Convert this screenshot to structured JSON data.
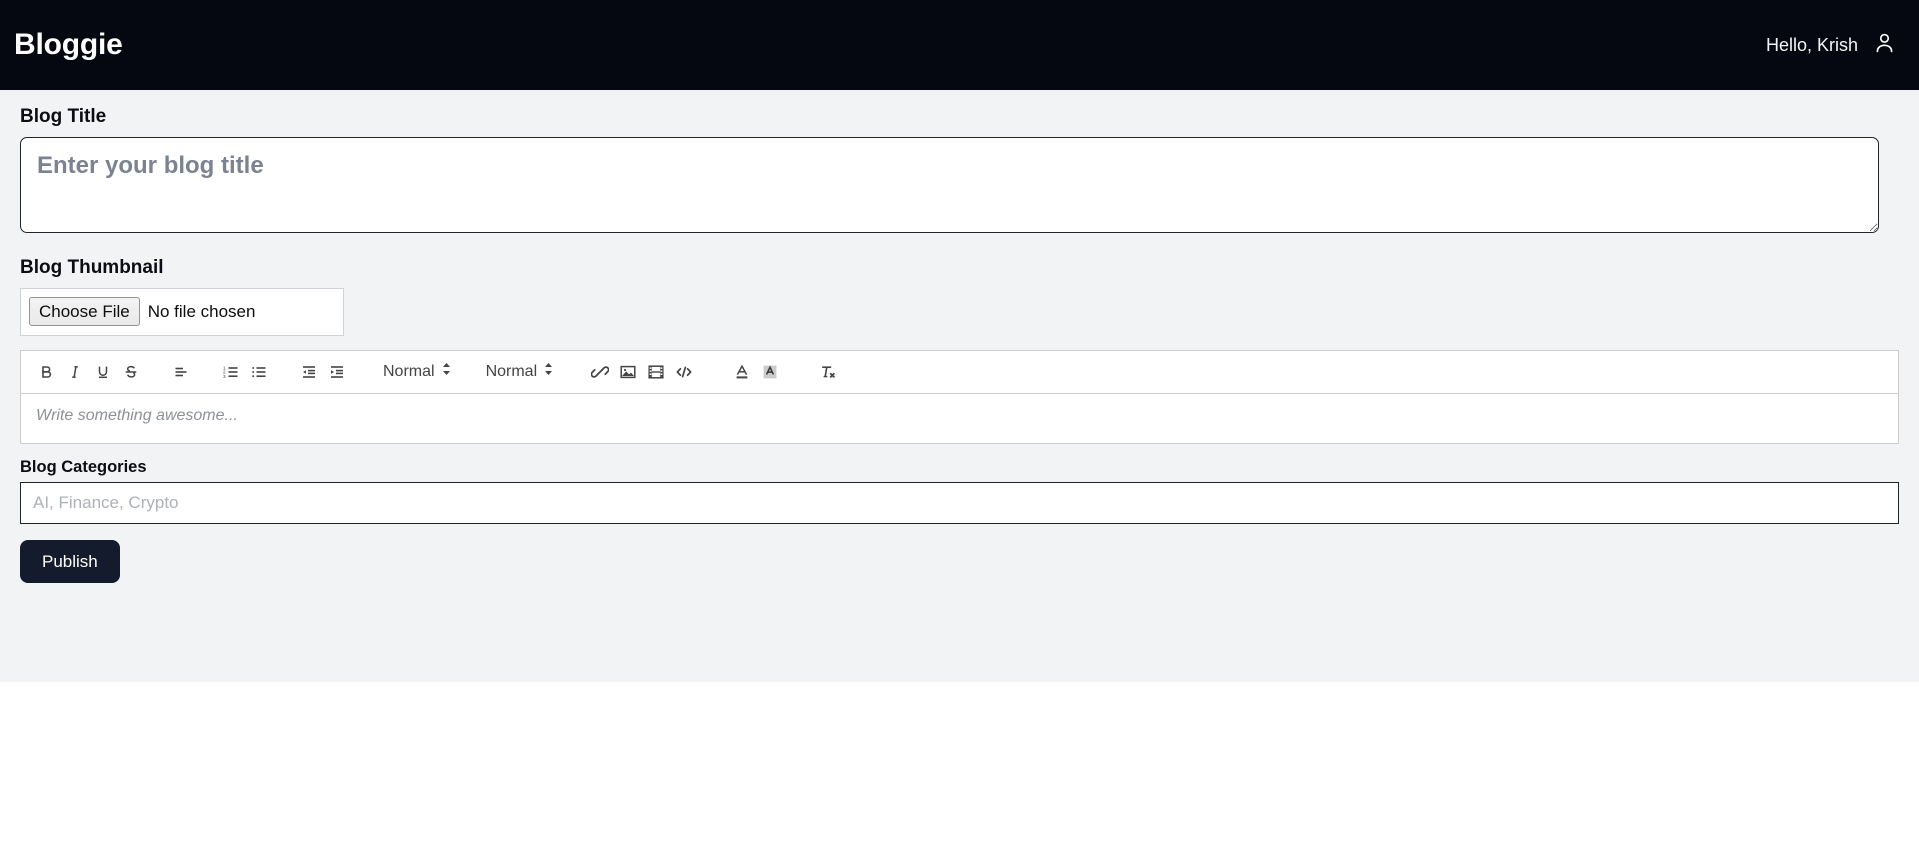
{
  "header": {
    "brand": "Bloggie",
    "greeting": "Hello, Krish",
    "user_icon": "user-icon",
    "background_color": "#050811",
    "text_color": "#ffffff"
  },
  "form": {
    "background_color": "#f1f3f5",
    "title": {
      "label": "Blog Title",
      "placeholder": "Enter your blog title",
      "value": ""
    },
    "thumbnail": {
      "label": "Blog Thumbnail",
      "choose_file_label": "Choose File",
      "file_status": "No file chosen"
    },
    "editor": {
      "placeholder": "Write something awesome...",
      "value": "",
      "toolbar": {
        "bold": {
          "label": "B",
          "icon": "bold-icon"
        },
        "italic": {
          "label": "I",
          "icon": "italic-icon"
        },
        "underline": {
          "label": "U",
          "icon": "underline-icon"
        },
        "strike": {
          "label": "S",
          "icon": "strikethrough-icon"
        },
        "align": {
          "icon": "align-icon"
        },
        "ordered_list": {
          "icon": "ordered-list-icon"
        },
        "bullet_list": {
          "icon": "bullet-list-icon"
        },
        "outdent": {
          "icon": "outdent-icon"
        },
        "indent": {
          "icon": "indent-icon"
        },
        "size_picker": {
          "value": "Normal",
          "icon": "chevron-updown-icon"
        },
        "header_picker": {
          "value": "Normal",
          "icon": "chevron-updown-icon"
        },
        "link": {
          "icon": "link-icon"
        },
        "image": {
          "icon": "image-icon"
        },
        "video": {
          "icon": "video-icon"
        },
        "code_block": {
          "icon": "code-block-icon"
        },
        "text_color": {
          "icon": "text-color-icon"
        },
        "background_color": {
          "icon": "background-color-icon"
        },
        "clean": {
          "icon": "clear-formatting-icon"
        }
      }
    },
    "categories": {
      "label": "Blog Categories",
      "placeholder": "AI, Finance, Crypto",
      "value": ""
    },
    "publish": {
      "label": "Publish",
      "background_color": "#141b2d"
    }
  }
}
